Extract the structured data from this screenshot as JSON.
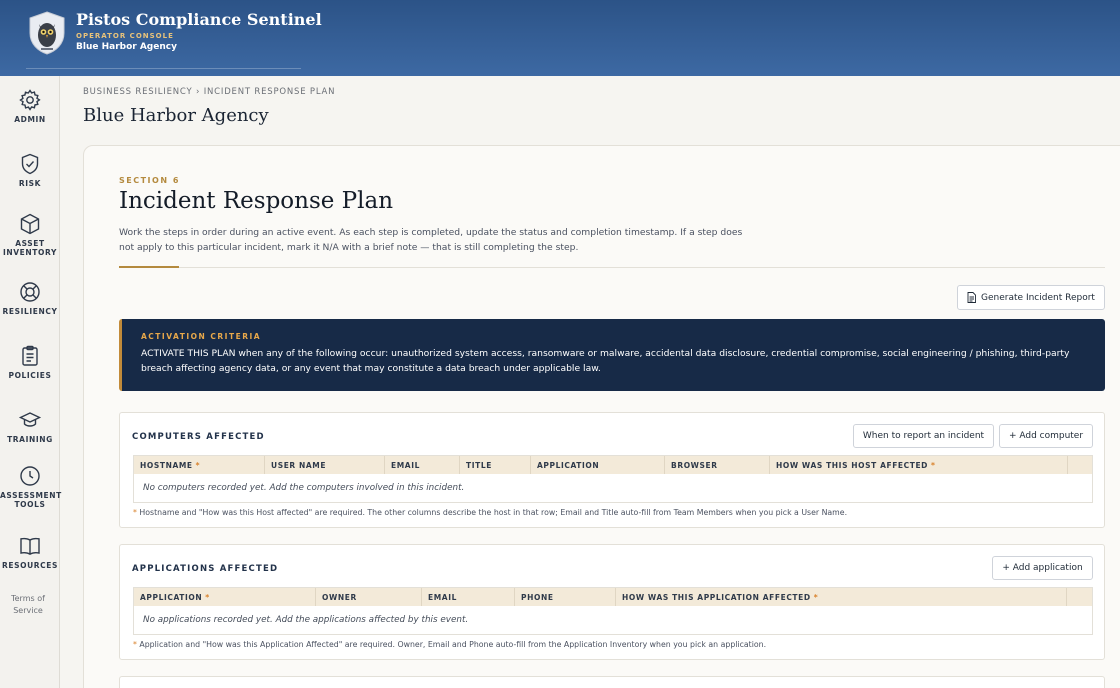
{
  "header": {
    "title": "Pistos Compliance Sentinel",
    "subtitle": "OPERATOR CONSOLE",
    "agency": "Blue Harbor Agency"
  },
  "sidebar": {
    "items": [
      {
        "label": "ADMIN",
        "icon": "gear-icon"
      },
      {
        "label": "RISK",
        "icon": "shield-check-icon"
      },
      {
        "label": "ASSET\nINVENTORY",
        "icon": "cube-icon"
      },
      {
        "label": "RESILIENCY",
        "icon": "lifebuoy-icon"
      },
      {
        "label": "POLICIES",
        "icon": "clipboard-icon"
      },
      {
        "label": "TRAINING",
        "icon": "graduation-cap-icon"
      },
      {
        "label": "ASSESSMENT\nTOOLS",
        "icon": "clock-icon"
      },
      {
        "label": "RESOURCES",
        "icon": "book-icon"
      }
    ],
    "terms": "Terms of Service"
  },
  "main": {
    "breadcrumb": "BUSINESS RESILIENCY › INCIDENT RESPONSE PLAN",
    "agency_title": "Blue Harbor Agency",
    "section_label": "SECTION 6",
    "plan_title": "Incident Response Plan",
    "plan_description": "Work the steps in order during an active event. As each step is completed, update the status and completion timestamp. If a step does not apply to this particular incident, mark it N/A with a brief note — that is still completing the step.",
    "generate_report_label": "Generate Incident Report",
    "activation": {
      "label": "ACTIVATION CRITERIA",
      "text": "ACTIVATE THIS PLAN when any of the following occur: unauthorized system access, ransomware or malware, accidental data disclosure, credential compromise, social engineering / phishing, third-party breach affecting agency data, or any event that may constitute a data breach under applicable law."
    },
    "computers": {
      "title": "COMPUTERS AFFECTED",
      "when_to_report_label": "When to report an incident",
      "add_label": "+ Add computer",
      "columns": [
        "HOSTNAME",
        "USER NAME",
        "EMAIL",
        "TITLE",
        "APPLICATION",
        "BROWSER",
        "HOW WAS THIS HOST AFFECTED"
      ],
      "empty": "No computers recorded yet. Add the computers involved in this incident.",
      "footnote": "Hostname and \"How was this Host affected\" are required. The other columns describe the host in that row; Email and Title auto-fill from Team Members when you pick a User Name."
    },
    "applications": {
      "title": "APPLICATIONS AFFECTED",
      "add_label": "+ Add application",
      "columns": [
        "APPLICATION",
        "OWNER",
        "EMAIL",
        "PHONE",
        "HOW WAS THIS APPLICATION AFFECTED"
      ],
      "empty": "No applications recorded yet. Add the applications affected by this event.",
      "footnote": "Application and \"How was this Application Affected\" are required. Owner, Email and Phone auto-fill from the Application Inventory when you pick an application."
    },
    "required_marker": "*"
  }
}
